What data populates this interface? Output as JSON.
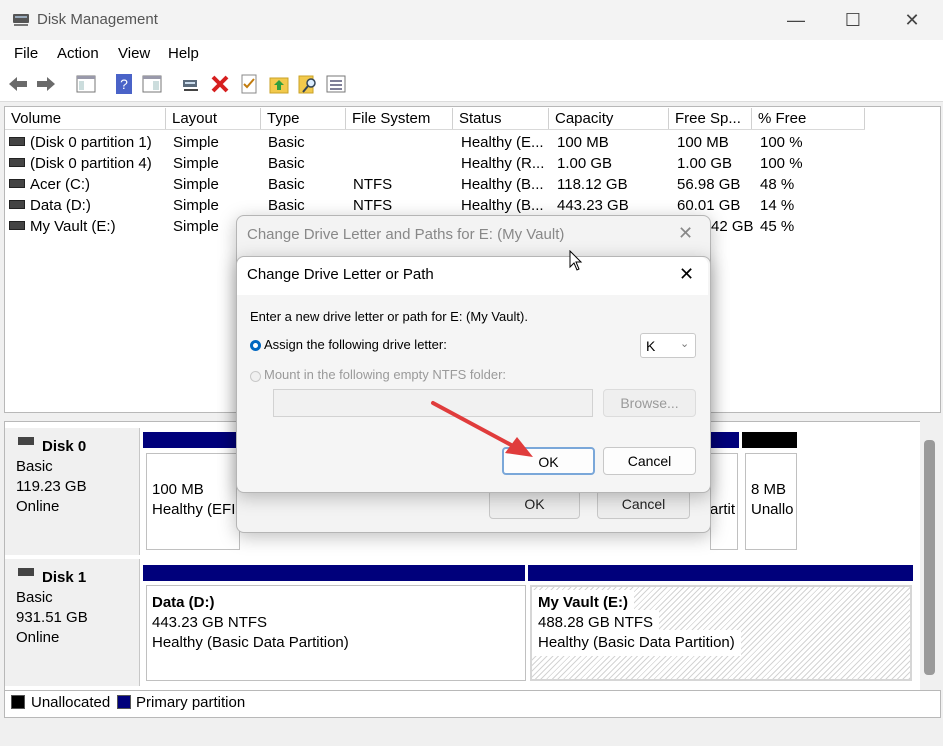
{
  "window": {
    "title": "Disk Management",
    "minimize_glyph": "—",
    "maximize_glyph": "☐",
    "close_glyph": "✕"
  },
  "menu": [
    "File",
    "Action",
    "View",
    "Help"
  ],
  "toolbar": {
    "icons": [
      "back-arrow-icon",
      "forward-arrow-icon",
      "console-tree-icon",
      "help-icon",
      "show-hide-icon",
      "connect-icon",
      "delete-icon",
      "check-properties-icon",
      "up-folder-icon",
      "search-icon",
      "list-view-icon"
    ]
  },
  "volume_list": {
    "columns": [
      "Volume",
      "Layout",
      "Type",
      "File System",
      "Status",
      "Capacity",
      "Free Sp...",
      "% Free"
    ],
    "rows": [
      [
        "(Disk 0 partition 1)",
        "Simple",
        "Basic",
        "",
        "Healthy (E...",
        "100 MB",
        "100 MB",
        "100 %"
      ],
      [
        "(Disk 0 partition 4)",
        "Simple",
        "Basic",
        "",
        "Healthy (R...",
        "1.00 GB",
        "1.00 GB",
        "100 %"
      ],
      [
        "Acer (C:)",
        "Simple",
        "Basic",
        "NTFS",
        "Healthy (B...",
        "118.12 GB",
        "56.98 GB",
        "48 %"
      ],
      [
        "Data (D:)",
        "Simple",
        "Basic",
        "NTFS",
        "Healthy (B...",
        "443.23 GB",
        "60.01 GB",
        "14 %"
      ],
      [
        "My Vault (E:)",
        "Simple",
        "",
        "",
        "",
        "",
        "42 GB",
        "45 %"
      ]
    ]
  },
  "disks": [
    {
      "name": "Disk 0",
      "type": "Basic",
      "size": "119.23 GB",
      "state": "Online",
      "partitions": [
        {
          "line1": "100 MB",
          "line2": "Healthy (EFI"
        },
        {
          "line1": "",
          "line2": "artit"
        },
        {
          "line1": "8 MB",
          "line2": "Unallo"
        }
      ]
    },
    {
      "name": "Disk 1",
      "type": "Basic",
      "size": "931.51 GB",
      "state": "Online",
      "partitions": [
        {
          "title": "Data  (D:)",
          "line1": "443.23 GB NTFS",
          "line2": "Healthy (Basic Data Partition)"
        },
        {
          "title": "My Vault  (E:)",
          "line1": "488.28 GB NTFS",
          "line2": "Healthy (Basic Data Partition)"
        }
      ]
    }
  ],
  "legend": [
    {
      "label": "Unallocated",
      "color": "#000000"
    },
    {
      "label": "Primary partition",
      "color": "#00007b"
    }
  ],
  "outer_dialog": {
    "title": "Change Drive Letter and Paths for E: (My Vault)",
    "ok": "OK",
    "cancel": "Cancel"
  },
  "inner_dialog": {
    "title": "Change Drive Letter or Path",
    "prompt": "Enter a new drive letter or path for E: (My Vault).",
    "option_assign": "Assign the following drive letter:",
    "option_mount": "Mount in the following empty NTFS folder:",
    "drive_letter": "K",
    "browse": "Browse...",
    "ok": "OK",
    "cancel": "Cancel"
  },
  "colors": {
    "primary_partition": "#00007b",
    "annotation_arrow": "#e03c3c",
    "radio_selected": "#0067c0"
  }
}
